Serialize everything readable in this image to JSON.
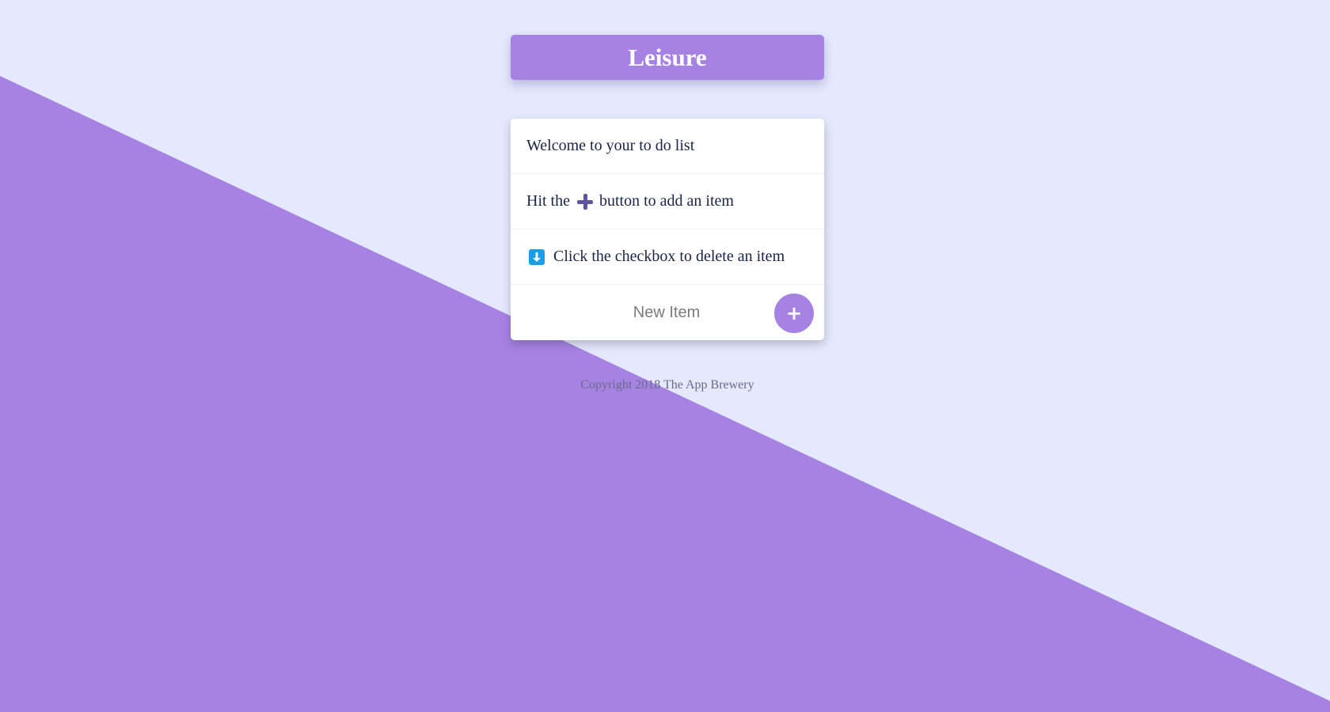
{
  "colors": {
    "background": "#E4E9FD",
    "accent": "#A683E3",
    "text_dark": "#1A2446",
    "footer_text": "#6A6A8A",
    "plus_icon": "#5E54A0",
    "down_arrow_icon_bg": "#1A9EE6"
  },
  "header": {
    "title": "Leisure"
  },
  "list": {
    "items": [
      {
        "text": "Welcome to your to do list"
      },
      {
        "prefix": "Hit the",
        "icon": "plus-icon",
        "suffix": "button to add an item"
      },
      {
        "icon": "down-arrow-icon",
        "text": "Click the checkbox to delete an item"
      }
    ]
  },
  "new_item": {
    "placeholder": "New Item",
    "button_label": "+"
  },
  "footer": {
    "text": "Copyright 2018 The App Brewery"
  }
}
